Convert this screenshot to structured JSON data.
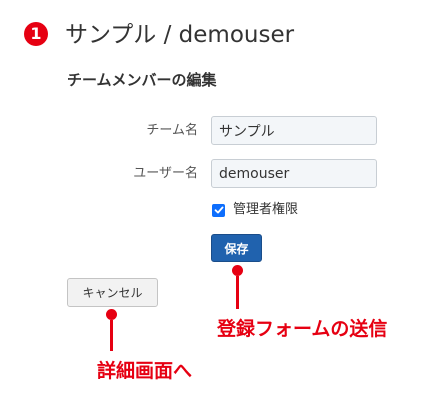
{
  "header": {
    "step_number": "1",
    "title": "サンプル / demouser"
  },
  "form": {
    "section_title": "チームメンバーの編集",
    "team_name_label": "チーム名",
    "team_name_value": "サンプル",
    "user_name_label": "ユーザー名",
    "user_name_value": "demouser",
    "admin_checkbox_label": "管理者権限",
    "admin_checked": true,
    "save_label": "保存",
    "cancel_label": "キャンセル"
  },
  "annotations": {
    "save_note": "登録フォームの送信",
    "cancel_note": "詳細画面へ"
  },
  "colors": {
    "annotation_red": "#e60012",
    "primary_button": "#2062ae",
    "checkbox_blue": "#0d6efd"
  }
}
